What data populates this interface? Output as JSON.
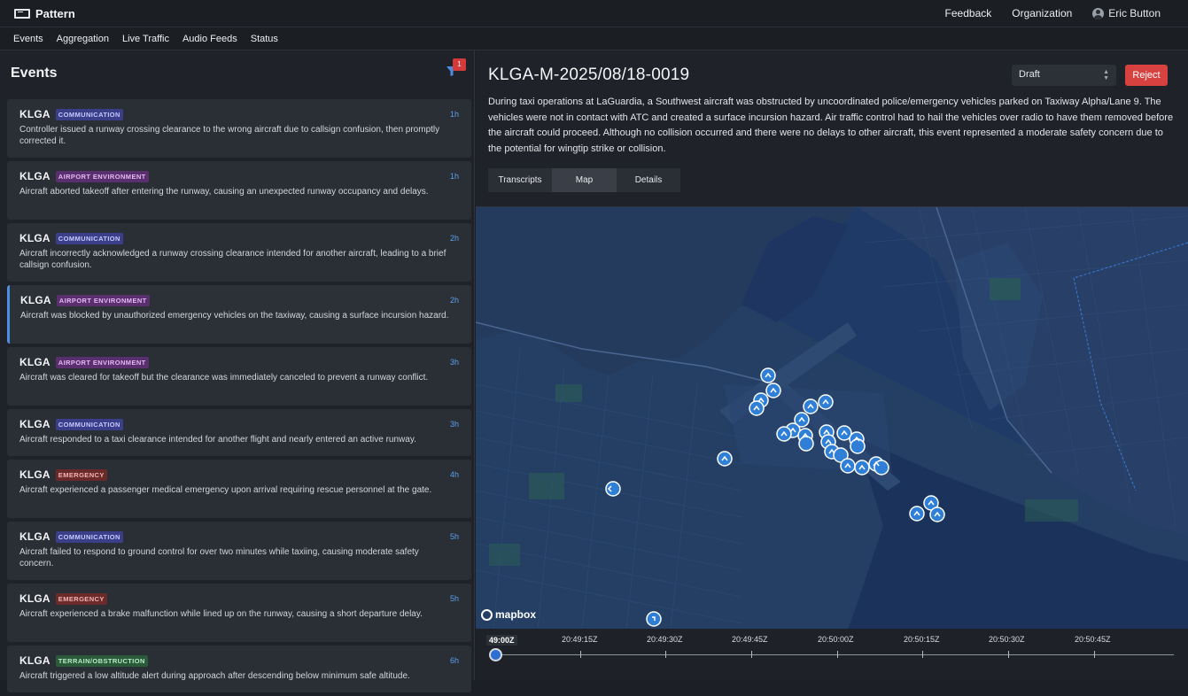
{
  "app": {
    "brand": "Pattern"
  },
  "top_nav": {
    "feedback": "Feedback",
    "organization": "Organization",
    "user": "Eric Button"
  },
  "nav": [
    "Events",
    "Aggregation",
    "Live Traffic",
    "Audio Feeds",
    "Status"
  ],
  "events_panel": {
    "title": "Events",
    "filter_count": "1",
    "items": [
      {
        "code": "KLGA",
        "tag": "COMMUNICATION",
        "age": "1h",
        "desc": "Controller issued a runway crossing clearance to the wrong aircraft due to callsign confusion, then promptly corrected it."
      },
      {
        "code": "KLGA",
        "tag": "AIRPORT ENVIRONMENT",
        "age": "1h",
        "desc": "Aircraft aborted takeoff after entering the runway, causing an unexpected runway occupancy and delays."
      },
      {
        "code": "KLGA",
        "tag": "COMMUNICATION",
        "age": "2h",
        "desc": "Aircraft incorrectly acknowledged a runway crossing clearance intended for another aircraft, leading to a brief callsign confusion."
      },
      {
        "code": "KLGA",
        "tag": "AIRPORT ENVIRONMENT",
        "age": "2h",
        "desc": "Aircraft was blocked by unauthorized emergency vehicles on the taxiway, causing a surface incursion hazard."
      },
      {
        "code": "KLGA",
        "tag": "AIRPORT ENVIRONMENT",
        "age": "3h",
        "desc": "Aircraft was cleared for takeoff but the clearance was immediately canceled to prevent a runway conflict."
      },
      {
        "code": "KLGA",
        "tag": "COMMUNICATION",
        "age": "3h",
        "desc": "Aircraft responded to a taxi clearance intended for another flight and nearly entered an active runway."
      },
      {
        "code": "KLGA",
        "tag": "EMERGENCY",
        "age": "4h",
        "desc": "Aircraft experienced a passenger medical emergency upon arrival requiring rescue personnel at the gate."
      },
      {
        "code": "KLGA",
        "tag": "COMMUNICATION",
        "age": "5h",
        "desc": "Aircraft failed to respond to ground control for over two minutes while taxiing, causing moderate safety concern."
      },
      {
        "code": "KLGA",
        "tag": "EMERGENCY",
        "age": "5h",
        "desc": "Aircraft experienced a brake malfunction while lined up on the runway, causing a short departure delay."
      },
      {
        "code": "KLGA",
        "tag": "TERRAIN/OBSTRUCTION",
        "age": "6h",
        "desc": "Aircraft triggered a low altitude alert during approach after descending below minimum safe altitude."
      }
    ]
  },
  "tag_colors": {
    "COMMUNICATION": {
      "bg": "#3b3f8a",
      "fg": "#c6c9ff"
    },
    "AIRPORT ENVIRONMENT": {
      "bg": "#5a2f6e",
      "fg": "#e4b8f5"
    },
    "EMERGENCY": {
      "bg": "#6b2a2a",
      "fg": "#f3b3b3"
    },
    "TERRAIN/OBSTRUCTION": {
      "bg": "#2b5a3a",
      "fg": "#b7ebc6"
    }
  },
  "detail": {
    "title": "KLGA-M-2025/08/18-0019",
    "status": "Draft",
    "reject": "Reject",
    "summary": "During taxi operations at LaGuardia, a Southwest aircraft was obstructed by uncoordinated police/emergency vehicles parked on Taxiway Alpha/Lane 9. The vehicles were not in contact with ATC and created a surface incursion hazard. Air traffic control had to hail the vehicles over radio to have them removed before the aircraft could proceed. Although no collision occurred and there were no delays to other aircraft, this event represented a moderate safety concern due to the potential for wingtip strike or collision.",
    "tabs": [
      "Transcripts",
      "Map",
      "Details"
    ],
    "active_tab": "Map"
  },
  "map": {
    "attribution": "mapbox"
  },
  "timeline": {
    "labels": [
      "49:00Z",
      "20:49:15Z",
      "20:49:30Z",
      "20:49:45Z",
      "20:50:00Z",
      "20:50:15Z",
      "20:50:30Z",
      "20:50:45Z"
    ]
  }
}
